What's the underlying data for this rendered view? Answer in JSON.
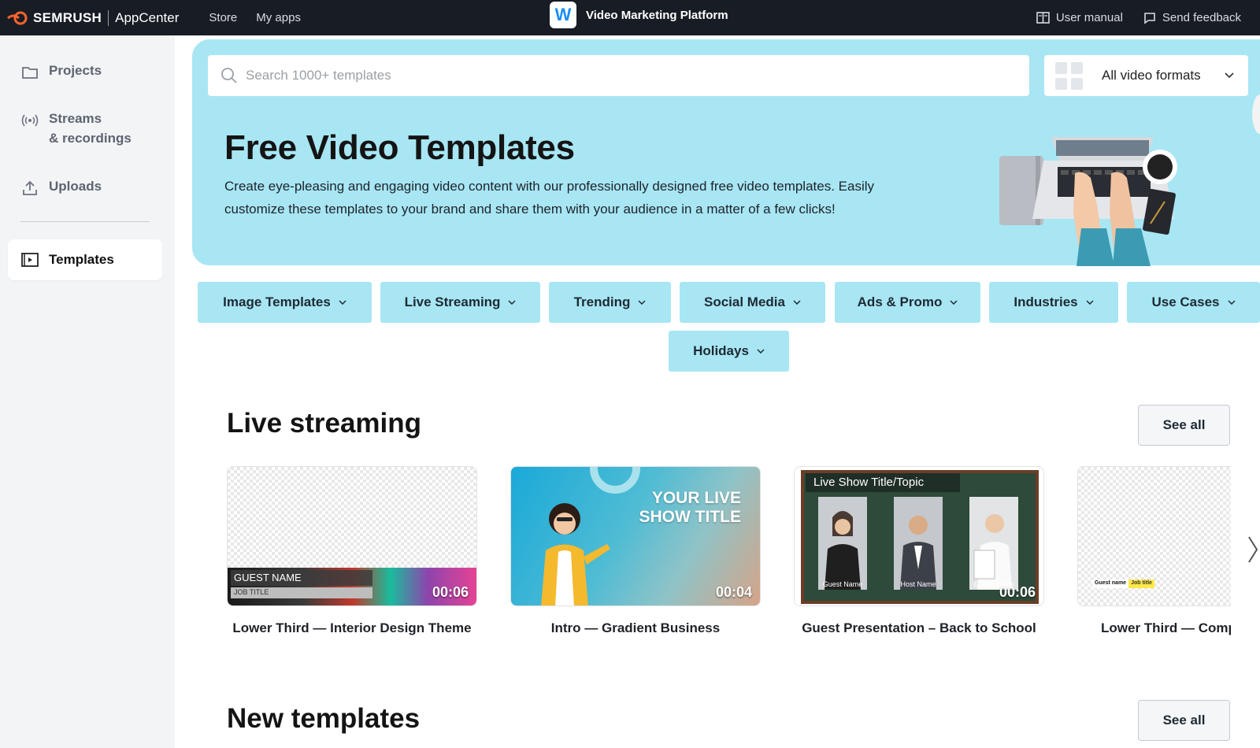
{
  "topbar": {
    "brand": "SEMRUSH",
    "app_center": "AppCenter",
    "nav": [
      "Store",
      "My apps"
    ],
    "app_logo_letter": "W",
    "app_title": "Video Marketing Platform",
    "user_manual": "User manual",
    "send_feedback": "Send feedback"
  },
  "sidebar": {
    "items": [
      {
        "label": "Projects",
        "icon": "folder-icon"
      },
      {
        "label": "Streams",
        "label2": "& recordings",
        "icon": "broadcast-icon"
      },
      {
        "label": "Uploads",
        "icon": "upload-icon"
      },
      {
        "label": "Templates",
        "icon": "templates-icon",
        "active": true
      }
    ]
  },
  "hero": {
    "search_placeholder": "Search 1000+ templates",
    "format_select": "All video formats",
    "title": "Free Video Templates",
    "description": "Create eye-pleasing and engaging video content with our professionally designed free video templates. Easily customize these templates to your brand and share them with your audience in a matter of a few clicks!"
  },
  "categories": [
    "Image Templates",
    "Live Streaming",
    "Trending",
    "Social Media",
    "Ads & Promo",
    "Industries",
    "Use Cases",
    "Holidays"
  ],
  "live_streaming": {
    "title": "Live streaming",
    "see_all": "See all",
    "cards": [
      {
        "title": "Lower Third — Interior Design Theme",
        "duration": "00:06",
        "overlay_name": "GUEST NAME",
        "overlay_job": "JOB TITLE"
      },
      {
        "title": "Intro — Gradient Business",
        "duration": "00:04",
        "overlay_line1": "YOUR LIVE",
        "overlay_line2": "SHOW TITLE"
      },
      {
        "title": "Guest Presentation – Back to School",
        "duration": "00:06",
        "overlay_topic": "Live Show Title/Topic",
        "names": [
          "Guest Name",
          "Host Name",
          "Guest Name"
        ]
      },
      {
        "title": "Lower Third — Comp",
        "duration": "",
        "overlay_name": "Guest name",
        "overlay_job": "Job title"
      }
    ]
  },
  "new_templates": {
    "title": "New templates",
    "see_all": "See all"
  },
  "colors": {
    "accent_light_blue": "#a8e6f4",
    "topbar_bg": "#181c24",
    "brand_orange": "#ff642d",
    "app_blue": "#1b8ef2"
  }
}
